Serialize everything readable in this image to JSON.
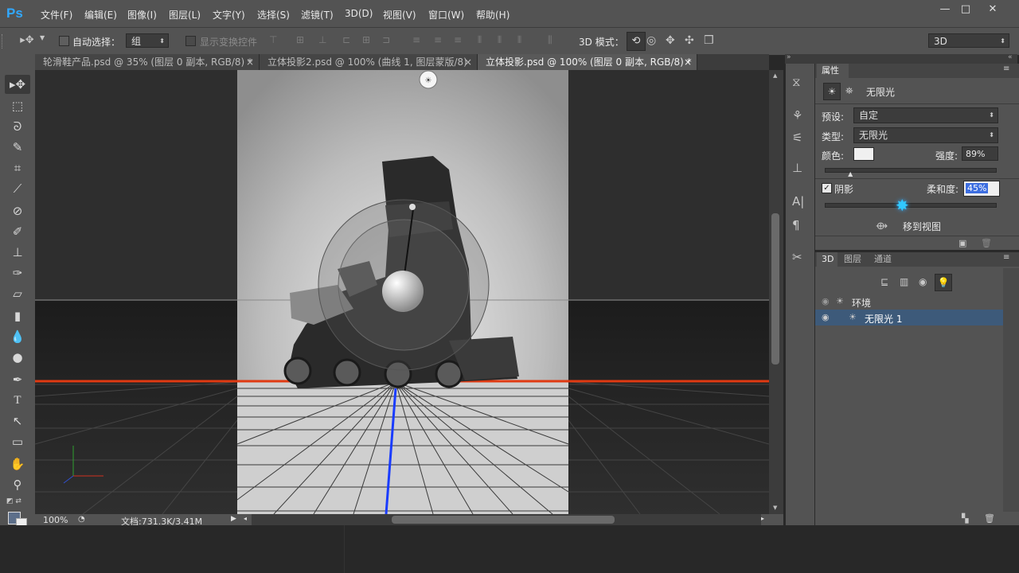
{
  "app": {
    "logo": "Ps"
  },
  "menu": [
    "文件(F)",
    "编辑(E)",
    "图像(I)",
    "图层(L)",
    "文字(Y)",
    "选择(S)",
    "滤镜(T)",
    "3D(D)",
    "视图(V)",
    "窗口(W)",
    "帮助(H)"
  ],
  "window_controls": {
    "minimize": "—",
    "restore": "□",
    "close": "✕"
  },
  "options": {
    "auto_select_label": "自动选择：",
    "auto_select_value": "组",
    "show_transform_label": "显示变换控件",
    "mode_label": "3D 模式：",
    "workspace": "3D"
  },
  "tabs": [
    {
      "label": "轮滑鞋产品.psd @ 35% (图层 0 副本, RGB/8) *",
      "close": "×"
    },
    {
      "label": "立体投影2.psd @ 100% (曲线 1, 图层蒙版/8)",
      "close": "×"
    },
    {
      "label": "立体投影.psd @ 100% (图层 0 副本, RGB/8) *",
      "close": "×"
    }
  ],
  "status": {
    "zoom": "100%",
    "doc": "文档:731.3K/3.41M"
  },
  "properties": {
    "tab": "属性",
    "light_name": "无限光",
    "preset_label": "预设:",
    "preset_value": "自定",
    "type_label": "类型:",
    "type_value": "无限光",
    "color_label": "颜色:",
    "color_value": "#f0f0f0",
    "intensity_label": "强度:",
    "intensity_value": "89%",
    "intensity_level": 0.15,
    "shadow_label": "阴影",
    "softness_label": "柔和度:",
    "softness_value": "45%",
    "softness_level": 0.45,
    "move_to_view": "移到视图"
  },
  "panel3d": {
    "tabs": [
      "3D",
      "图层",
      "通道"
    ],
    "items": [
      {
        "name": "环境"
      },
      {
        "name": "无限光 1"
      }
    ]
  },
  "colors": {
    "selection": "#3d5a7a",
    "accent": "#31a8ff",
    "ground_line": "#e03a12",
    "axis_blue": "#1a3cff"
  }
}
